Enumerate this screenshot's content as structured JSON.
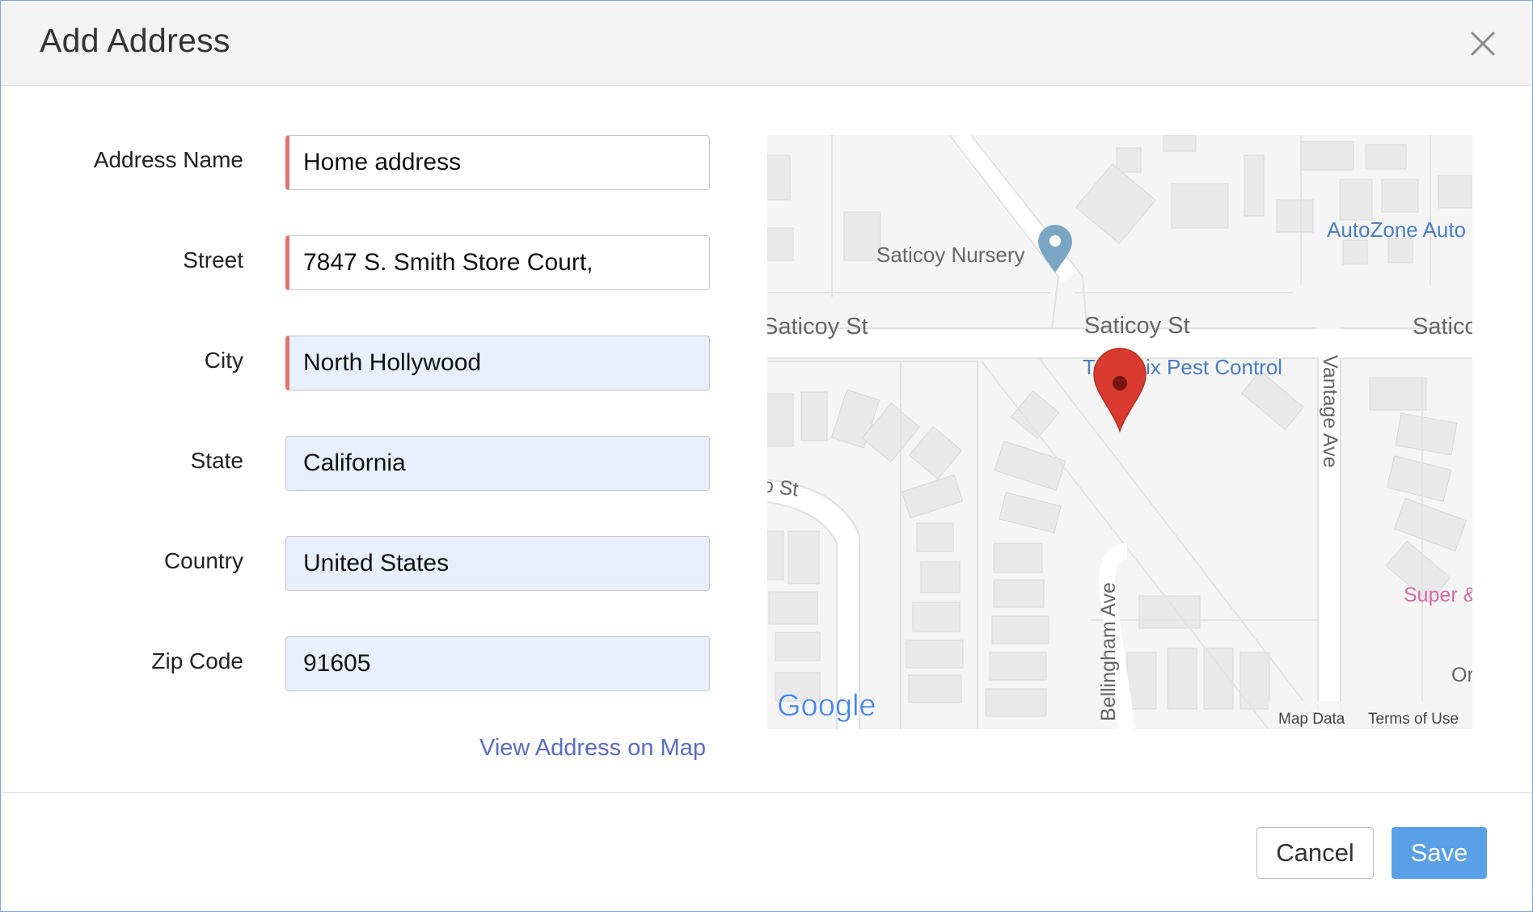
{
  "dialog": {
    "title": "Add Address",
    "close_icon": "close-icon"
  },
  "form": {
    "fields": [
      {
        "label": "Address Name",
        "value": "Home address",
        "required": true
      },
      {
        "label": "Street",
        "value": "7847 S. Smith Store Court,",
        "required": true
      },
      {
        "label": "City",
        "value": "North Hollywood",
        "required": true
      },
      {
        "label": "State",
        "value": "California",
        "required": false
      },
      {
        "label": "Country",
        "value": "United States",
        "required": false
      },
      {
        "label": "Zip Code",
        "value": "91605",
        "required": false
      }
    ],
    "view_on_map_link": "View Address on Map"
  },
  "map": {
    "street_labels": [
      "Saticoy St",
      "Saticoy St",
      "Saticoy St",
      "Vantage Ave",
      "Bellingham Ave",
      "llo St"
    ],
    "places": [
      "Saticoy Nursery",
      "Terminix Pest Control",
      "AutoZone Auto",
      "Super & No",
      "Or"
    ],
    "logo": "Google",
    "map_data_link": "Map Data",
    "terms_link": "Terms of Use",
    "marker_icon": "map-marker-icon",
    "place_pin_icon": "place-pin-icon",
    "colors": {
      "marker": "#d93b30",
      "place_label": "#4a7fc1",
      "pink_label": "#d66b9e",
      "street_label": "#666666"
    }
  },
  "footer": {
    "cancel_label": "Cancel",
    "save_label": "Save"
  },
  "colors": {
    "accent": "#5aa0e6",
    "link": "#5b6cc2",
    "required_marker": "#e0756e",
    "filled_field_bg": "#e8effd"
  }
}
